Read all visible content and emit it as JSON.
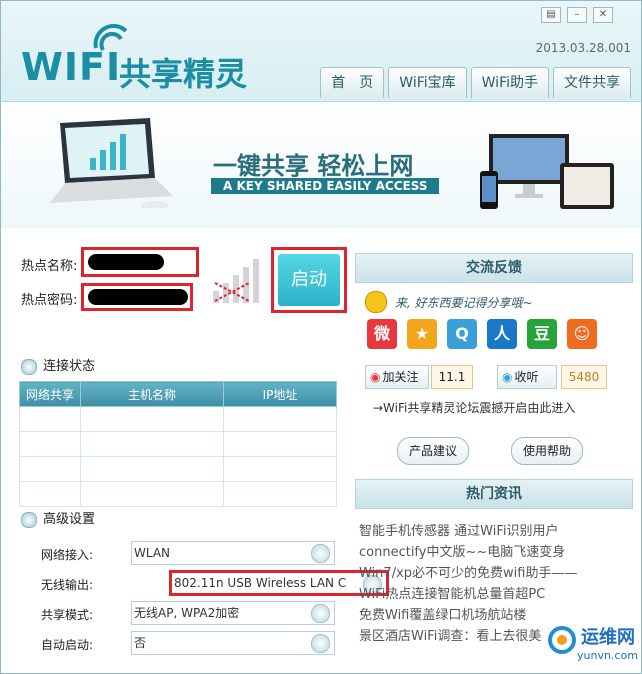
{
  "app": {
    "logo_text": "WIFI",
    "logo_cn": "共享精灵",
    "version": "2013.03.28.001"
  },
  "tabs": [
    "首　页",
    "WiFi宝库",
    "WiFi助手",
    "文件共享"
  ],
  "banner": {
    "title": "一键共享 轻松上网",
    "subtitle": "A KEY SHARED EASILY ACCESS"
  },
  "hotspot": {
    "name_label": "热点名称:",
    "password_label": "热点密码:",
    "start_label": "启动"
  },
  "connection": {
    "title": "连接状态",
    "columns": [
      "网络共享",
      "主机名称",
      "IP地址"
    ]
  },
  "advanced": {
    "title": "高级设置",
    "rows": [
      {
        "label": "网络接入:",
        "value": "WLAN"
      },
      {
        "label": "无线输出:",
        "value": "802.11n USB Wireless LAN C"
      },
      {
        "label": "共享模式:",
        "value": "无线AP, WPA2加密"
      },
      {
        "label": "自动启动:",
        "value": "否"
      }
    ]
  },
  "feedback": {
    "title": "交流反馈",
    "message": "来, 好东西要记得分享哦~",
    "follow_label": "加关注",
    "follow_count": "11.1",
    "listen_label": "收听",
    "listen_count": "5480",
    "forum_link": "→WiFi共享精灵论坛震撼开启由此进入",
    "suggest_button": "产品建议",
    "help_button": "使用帮助"
  },
  "news": {
    "title": "热门资讯",
    "items": [
      "智能手机传感器 通过WiFi识别用户",
      "connectify中文版~~电脑飞速变身",
      "Win7/xp必不可少的免费wifi助手——",
      "WiFi热点连接智能机总量首超PC",
      "免费Wifi覆盖绿口机场航站楼",
      "景区酒店WiFi调查：看上去很美"
    ]
  },
  "watermark": {
    "text_cn": "运维网",
    "text_en": "yunvn.com"
  },
  "colors": {
    "accent": "#2bb2c8",
    "highlight": "#e0242f",
    "header": "#d7eef2"
  }
}
